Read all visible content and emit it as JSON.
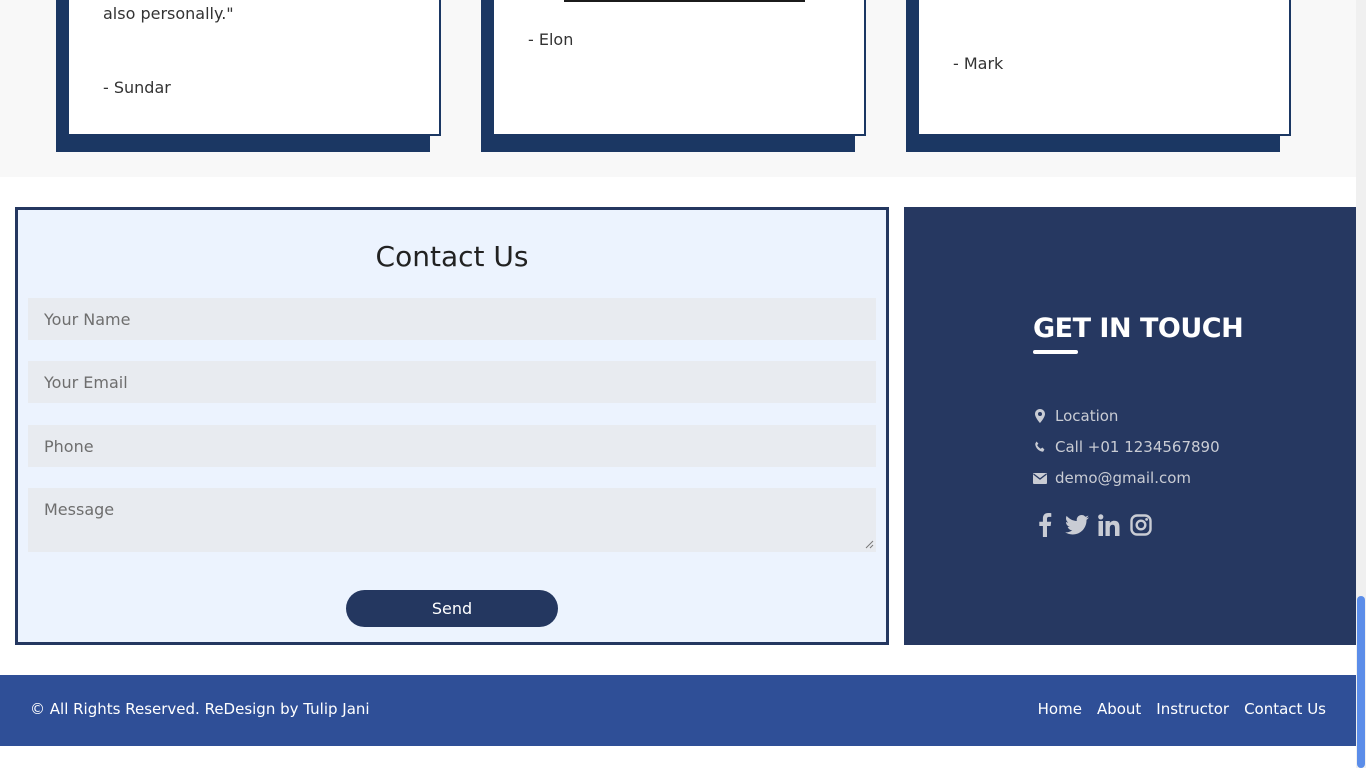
{
  "testimonials": [
    {
      "quote_tail": "also personally.\"",
      "author": "- Sundar"
    },
    {
      "quote_tail": "",
      "author": "- Elon"
    },
    {
      "quote_tail": "",
      "author": "- Mark"
    }
  ],
  "contact": {
    "title": "Contact Us",
    "name_placeholder": "Your Name",
    "email_placeholder": "Your Email",
    "phone_placeholder": "Phone",
    "message_placeholder": "Message",
    "send_label": "Send"
  },
  "touch": {
    "title": "GET IN TOUCH",
    "location": "Location",
    "call": "Call +01 1234567890",
    "email": "demo@gmail.com",
    "social_icons": [
      "facebook-icon",
      "twitter-icon",
      "linkedin-icon",
      "instagram-icon"
    ]
  },
  "footer": {
    "copyright": "© All Rights Reserved. ReDesign by Tulip Jani",
    "nav": [
      "Home",
      "About",
      "Instructor",
      "Contact Us"
    ]
  },
  "colors": {
    "navy": "#243760",
    "footer_blue": "#2f4f97",
    "form_bg": "#ecf3fe",
    "scroll_thumb": "#5b8de9"
  }
}
